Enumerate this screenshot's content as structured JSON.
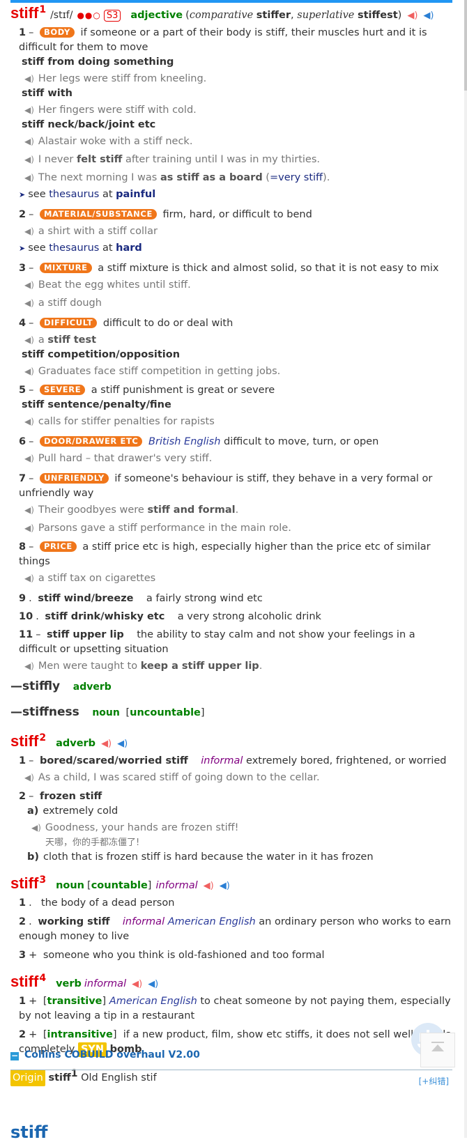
{
  "entry1": {
    "word": "stiff",
    "homnum": "1",
    "pron": "/stɪf/",
    "freq_dots": "●●○",
    "freq_level": "S3",
    "pos": "adjective",
    "gram_open": "(",
    "gram_comp_label": "comparative",
    "gram_comp": "stiffer",
    "gram_sup_label": "superlative",
    "gram_sup": "stiffest",
    "gram_close": ")",
    "senses": {
      "s1": {
        "num": "1",
        "tag": "BODY",
        "def": "if someone or a part of their body is stiff, their muscles hurt and it is difficult for them to move",
        "c1": "stiff from doing something",
        "e1": "Her legs were stiff from kneeling.",
        "c2": "stiff with",
        "e2": "Her fingers were stiff with cold.",
        "c3": "stiff neck/back/joint etc",
        "e3": "Alastair woke with a stiff neck.",
        "e4a": "I never ",
        "e4b": "felt stiff",
        "e4c": " after training until I was in my thirties.",
        "e5a": "The next morning I was ",
        "e5b": "as stiff as a board",
        "e5c": " (",
        "e5d": "=very stiff",
        "e5e": ").",
        "see_label": "see",
        "see_link": "thesaurus",
        "see_at": "at",
        "see_word": "painful"
      },
      "s2": {
        "num": "2",
        "tag": "MATERIAL/SUBSTANCE",
        "def": "firm, hard, or difficult to bend",
        "e1": "a shirt with a stiff collar",
        "see_label": "see",
        "see_link": "thesaurus",
        "see_at": "at",
        "see_word": "hard"
      },
      "s3": {
        "num": "3",
        "tag": "MIXTURE",
        "def": "a stiff mixture is thick and almost solid, so that it is not easy to mix",
        "e1": "Beat the egg whites until stiff.",
        "e2": "a stiff dough"
      },
      "s4": {
        "num": "4",
        "tag": "DIFFICULT",
        "def": "difficult to do or deal with",
        "e1a": "a ",
        "e1b": "stiff test",
        "c1": "stiff competition/opposition",
        "e2": "Graduates face stiff competition in getting jobs."
      },
      "s5": {
        "num": "5",
        "tag": "SEVERE",
        "def": "a stiff punishment is great or severe",
        "c1": "stiff sentence/penalty/fine",
        "e1": "calls for stiffer penalties for rapists"
      },
      "s6": {
        "num": "6",
        "tag": "DOOR/DRAWER ETC",
        "geo": "British English",
        "def": "difficult to move, turn, or open",
        "e1": "Pull hard – that drawer's very stiff."
      },
      "s7": {
        "num": "7",
        "tag": "UNFRIENDLY",
        "def": "if someone's behaviour is stiff, they behave in a very formal or unfriendly way",
        "e1a": "Their goodbyes were ",
        "e1b": "stiff and formal",
        "e1c": ".",
        "e2": "Parsons gave a stiff performance in the main role."
      },
      "s8": {
        "num": "8",
        "tag": "PRICE",
        "def": "a stiff price etc is high, especially higher than the price etc of similar things",
        "e1": "a stiff tax on cigarettes"
      },
      "s9": {
        "num": "9",
        "phrase": "stiff wind/breeze",
        "def": "a fairly strong wind etc"
      },
      "s10": {
        "num": "10",
        "phrase": "stiff drink/whisky etc",
        "def": "a very strong alcoholic drink"
      },
      "s11": {
        "num": "11",
        "phrase": "stiff upper lip",
        "def": "the ability to stay calm and not show your feelings in a difficult or upsetting situation",
        "e1a": "Men were taught to ",
        "e1b": "keep a stiff upper lip",
        "e1c": "."
      }
    },
    "deriv1_word": "—stiffly",
    "deriv1_pos": "adverb",
    "deriv2_word": "—stiffness",
    "deriv2_pos": "noun",
    "deriv2_gram": "uncountable"
  },
  "entry2": {
    "word": "stiff",
    "homnum": "2",
    "pos": "adverb",
    "s1_num": "1",
    "s1_phrase": "bored/scared/worried stiff",
    "s1_reg": "informal",
    "s1_def": "extremely bored, frightened, or worried",
    "s1_ex": "As a child, I was scared stiff of going down to the cellar.",
    "s2_num": "2",
    "s2_phrase": "frozen stiff",
    "s2a_letter": "a)",
    "s2a_def": "extremely cold",
    "s2a_ex": "Goodness, your hands are frozen stiff!",
    "s2a_cn": "天哪，你的手都冻僵了!",
    "s2b_letter": "b)",
    "s2b_def": "cloth that is frozen stiff is hard because the water in it has frozen"
  },
  "entry3": {
    "word": "stiff",
    "homnum": "3",
    "pos": "noun",
    "gram": "countable",
    "reg": "informal",
    "s1_num": "1",
    "s1_def": "the body of a dead person",
    "s2_num": "2",
    "s2_phrase": "working stiff",
    "s2_reg": "informal",
    "s2_geo": "American English",
    "s2_def": "an ordinary person who works to earn enough money to live",
    "s3_num": "3",
    "s3_def": "someone who you think is old-fashioned and too formal"
  },
  "entry4": {
    "word": "stiff",
    "homnum": "4",
    "pos": "verb",
    "reg": "informal",
    "s1_num": "1",
    "s1_gram": "transitive",
    "s1_geo": "American English",
    "s1_def": "to cheat someone by not paying them, especially by not leaving a tip in a restaurant",
    "s2_num": "2",
    "s2_gram": "intransitive",
    "s2_def": "if a new product, film, show etc stiffs, it does not sell well or fails completely",
    "s2_syn_label": "SYN",
    "s2_syn": "bomb"
  },
  "origin": {
    "label": "Origin",
    "word": "stiff",
    "homnum": "1",
    "text": "Old English stif"
  },
  "collins": {
    "title": "Collins COBUILD overhaul V2.00",
    "fix_link": "[+纠错]",
    "partial_word": "stiff"
  },
  "colors": {
    "headword": "#e60000",
    "pos": "#008000",
    "tag": "#f0761a",
    "accent": "#2196f3"
  },
  "icons": {
    "uk_audio": "speaker-red-icon",
    "us_audio": "speaker-blue-icon",
    "example_audio": "speaker-gray-icon",
    "back_to_top": "arrow-up-icon",
    "float_logo": "ship-icon"
  }
}
